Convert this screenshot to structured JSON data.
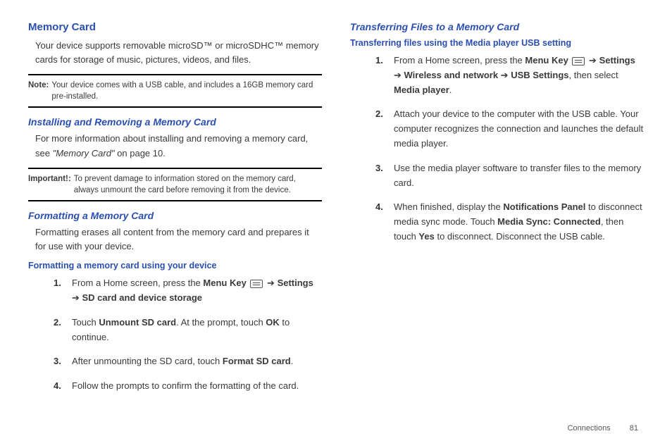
{
  "left": {
    "h1": "Memory Card",
    "intro": "Your device supports removable microSD™ or microSDHC™ memory cards for storage of music, pictures, videos, and files.",
    "note1_label": "Note:",
    "note1_text": "Your device comes with a USB cable, and includes a 16GB memory card pre-installed.",
    "h2a": "Installing and Removing a Memory Card",
    "para2_a": "For more information about installing and removing a memory card, see ",
    "para2_ref": "\"Memory Card\"",
    "para2_b": " on page 10.",
    "imp_label": "Important!:",
    "imp_text": "To prevent damage to information stored on the memory card, always unmount the card before removing it from the device.",
    "h2b": "Formatting a Memory Card",
    "para3": "Formatting erases all content from the memory card and prepares it for use with your device.",
    "h3": "Formatting a memory card using your device",
    "s1_a": "From a Home screen, press the ",
    "s1_menukey": "Menu Key",
    "s1_arrow": " ➔ ",
    "s1_settings": "Settings",
    "s1_arrow2": " ➔ ",
    "s1_sd": "SD card and device storage",
    "s2_a": "Touch ",
    "s2_b": "Unmount SD card",
    "s2_c": ". At the prompt, touch ",
    "s2_d": "OK",
    "s2_e": " to continue.",
    "s3_a": "After unmounting the SD card, touch ",
    "s3_b": "Format SD card",
    "s3_c": ".",
    "s4": "Follow the prompts to confirm the formatting of the card."
  },
  "right": {
    "h2": "Transferring Files to a Memory Card",
    "h3": "Transferring files using the Media player USB setting",
    "s1_a": "From a Home screen, press the ",
    "s1_menukey": "Menu Key",
    "s1_arrow": " ➔ ",
    "s1_settings": "Settings",
    "s1_arrow2": " ➔ ",
    "s1_wireless": "Wireless and network",
    "s1_arrow3": " ➔ ",
    "s1_usb": "USB Settings",
    "s1_then": ", then select ",
    "s1_media": "Media player",
    "s1_dot": ".",
    "s2": "Attach your device to the computer with the USB cable. Your computer recognizes the connection and launches the default media player.",
    "s3": "Use the media player software to transfer files to the memory card.",
    "s4_a": "When finished, display the ",
    "s4_b": "Notifications Panel",
    "s4_c": " to disconnect media sync mode. Touch ",
    "s4_d": "Media Sync: Connected",
    "s4_e": ", then touch ",
    "s4_f": "Yes",
    "s4_g": " to disconnect. Disconnect the USB cable."
  },
  "footer": {
    "section": "Connections",
    "page": "81"
  }
}
